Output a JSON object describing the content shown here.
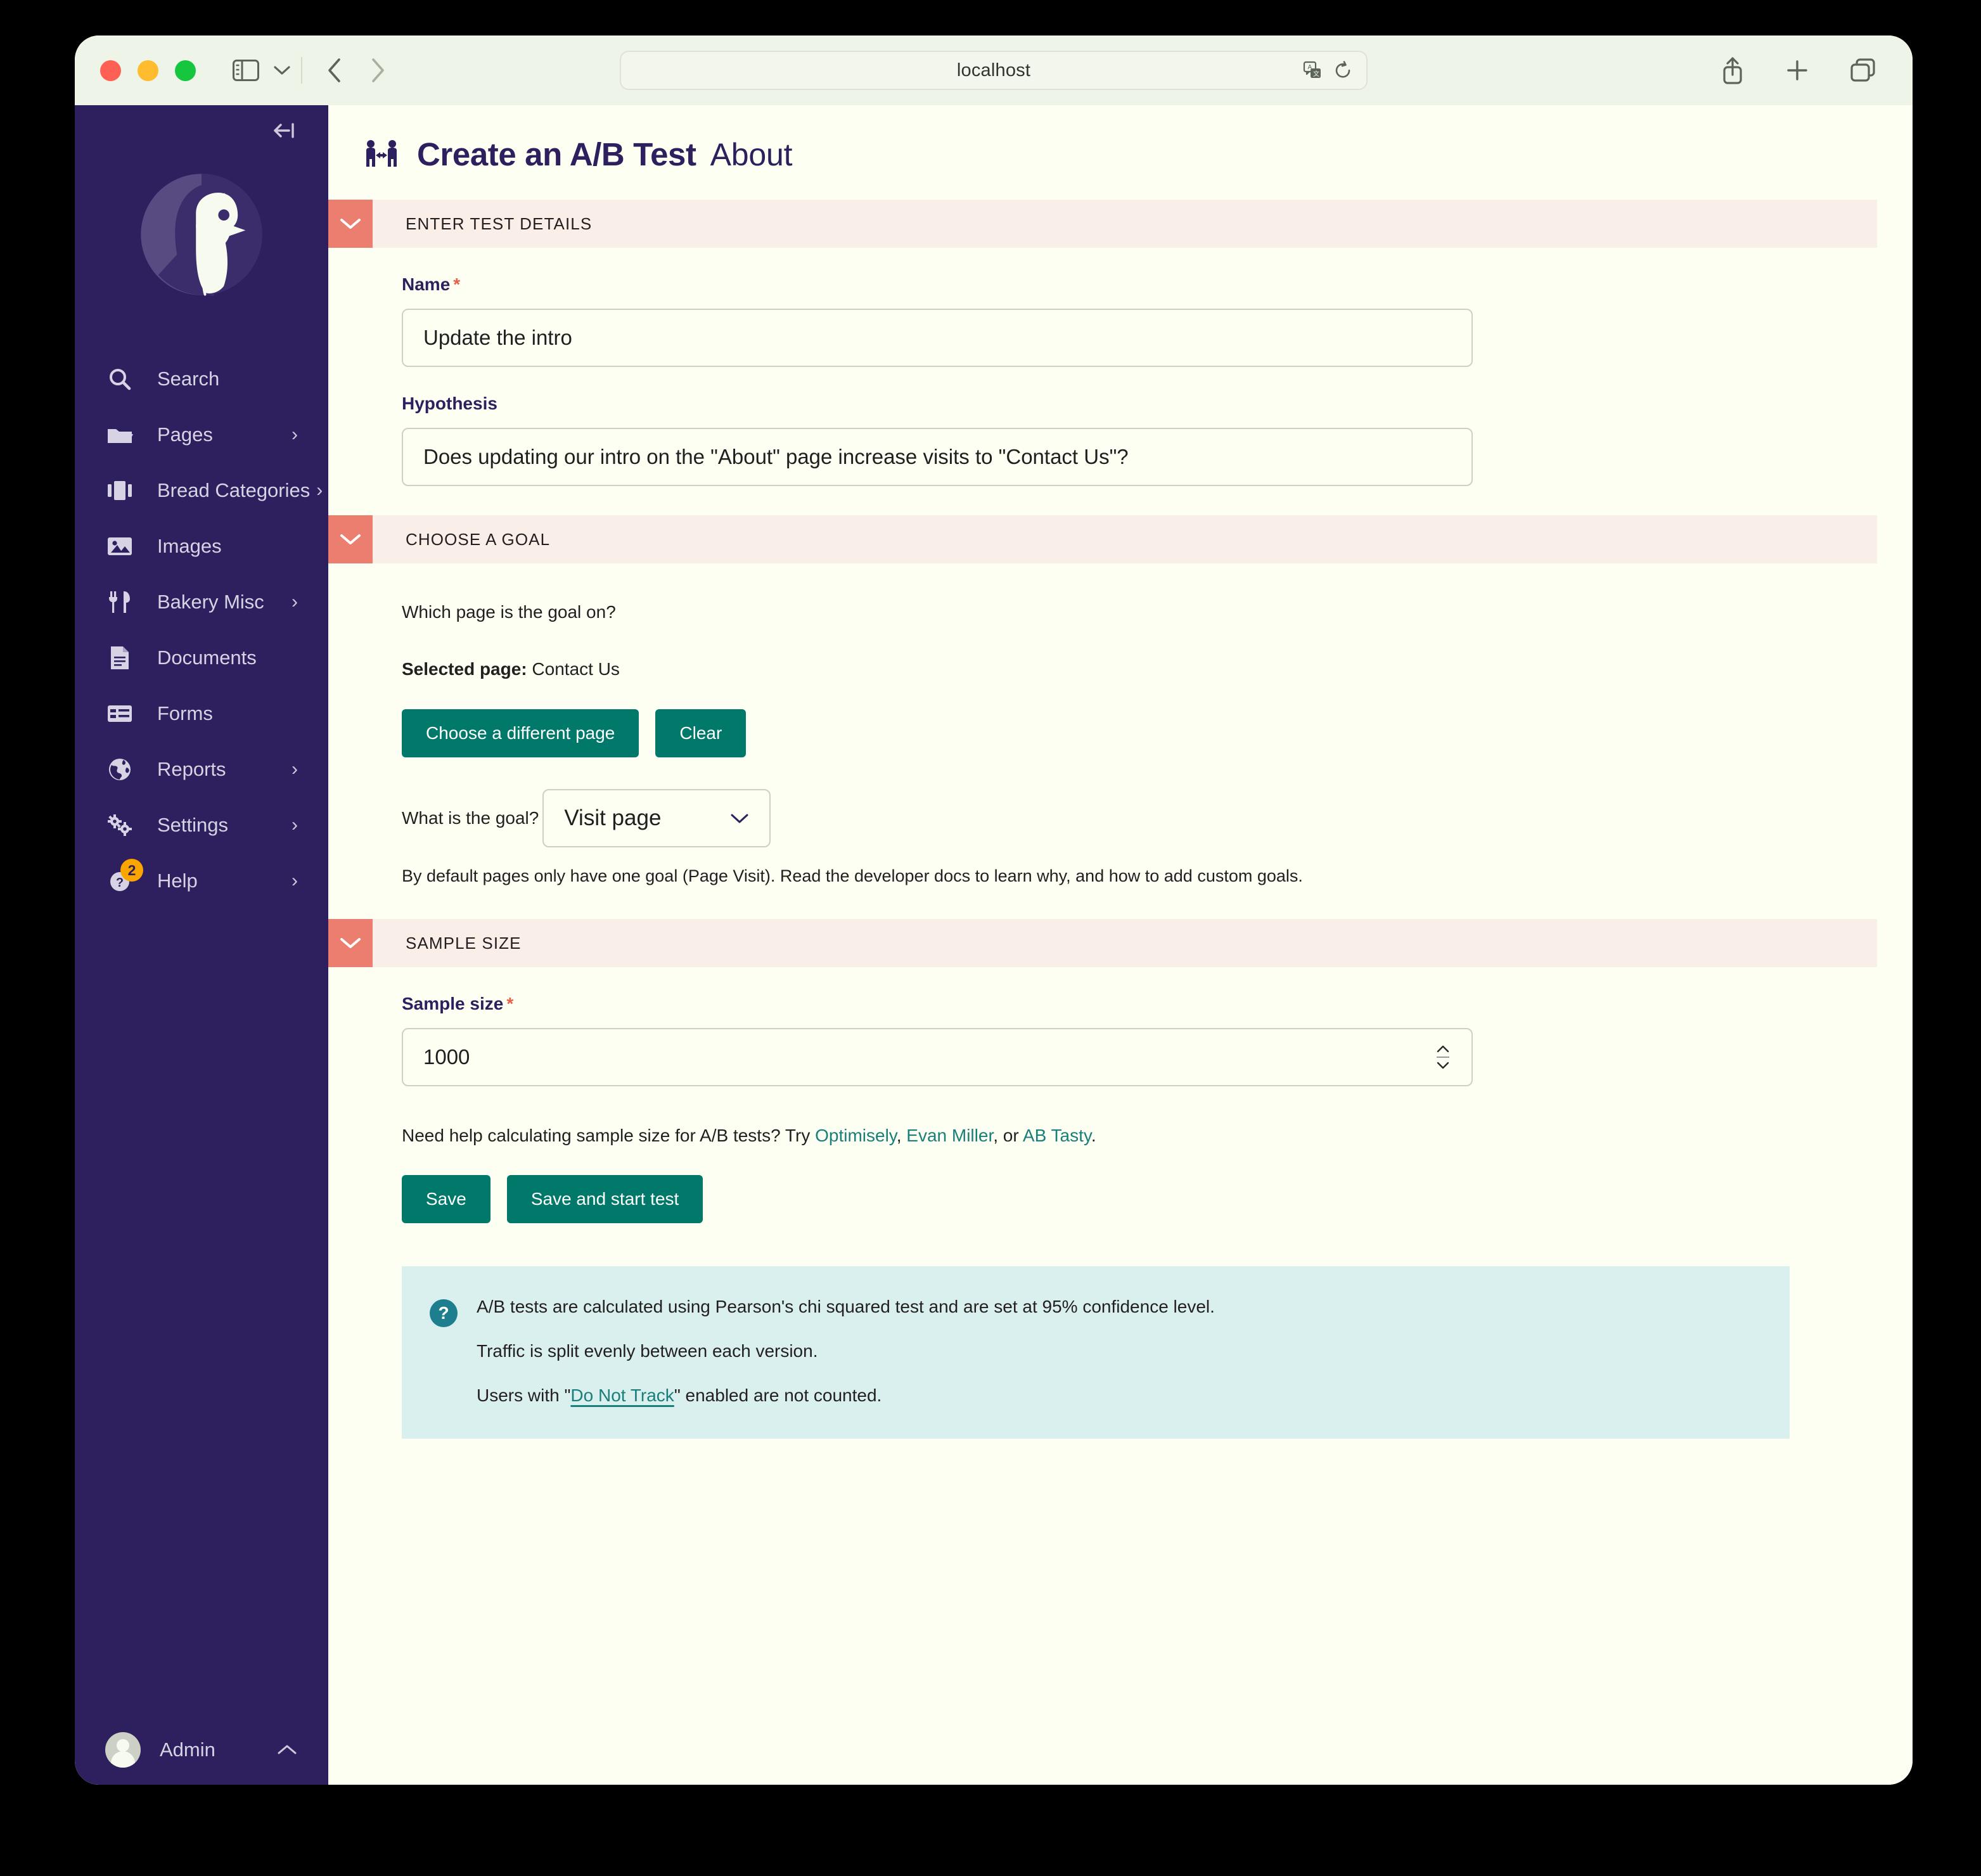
{
  "browser": {
    "url": "localhost",
    "icons": {
      "sidebar_toggle": "sidebar-toggle-icon",
      "tab_overview_chevron": "chevron-down-icon",
      "back": "back-arrow-icon",
      "forward": "forward-arrow-icon",
      "translate": "translate-icon",
      "reload": "reload-icon",
      "share": "share-icon",
      "new_tab": "plus-icon",
      "tabs": "tabs-icon"
    }
  },
  "sidebar": {
    "collapse_icon": "collapse-sidebar-icon",
    "logo": "wagtail-bird-logo",
    "items": [
      {
        "label": "Search",
        "icon": "search-icon",
        "has_submenu": false,
        "badge": null
      },
      {
        "label": "Pages",
        "icon": "folder-icon",
        "has_submenu": true,
        "badge": null
      },
      {
        "label": "Bread Categories",
        "icon": "snippets-icon",
        "has_submenu": true,
        "badge": null
      },
      {
        "label": "Images",
        "icon": "image-icon",
        "has_submenu": false,
        "badge": null
      },
      {
        "label": "Bakery Misc",
        "icon": "cutlery-icon",
        "has_submenu": true,
        "badge": null
      },
      {
        "label": "Documents",
        "icon": "document-icon",
        "has_submenu": false,
        "badge": null
      },
      {
        "label": "Forms",
        "icon": "forms-icon",
        "has_submenu": false,
        "badge": null
      },
      {
        "label": "Reports",
        "icon": "globe-icon",
        "has_submenu": true,
        "badge": null
      },
      {
        "label": "Settings",
        "icon": "cogs-icon",
        "has_submenu": true,
        "badge": null
      },
      {
        "label": "Help",
        "icon": "help-circle-icon",
        "has_submenu": true,
        "badge": "2"
      }
    ],
    "footer": {
      "name": "Admin",
      "avatar": "user-avatar",
      "caret": "chevron-up-icon"
    }
  },
  "header": {
    "icon": "ab-test-icon",
    "title": "Create an A/B Test",
    "subtitle": "About"
  },
  "sections": {
    "details": {
      "heading": "ENTER TEST DETAILS",
      "toggle_icon": "chevron-down-icon",
      "name": {
        "label": "Name",
        "required": "*",
        "value": "Update the intro"
      },
      "hypothesis": {
        "label": "Hypothesis",
        "value": "Does updating our intro on the \"About\" page increase visits to \"Contact Us\"?"
      }
    },
    "goal": {
      "heading": "CHOOSE A GOAL",
      "toggle_icon": "chevron-down-icon",
      "question": "Which page is the goal on?",
      "selected_page_label": "Selected page:",
      "selected_page_value": "Contact Us",
      "choose_button": "Choose a different page",
      "clear_button": "Clear",
      "goal_question": "What is the goal?",
      "goal_value": "Visit page",
      "goal_caret": "chevron-down-icon",
      "hint": "By default pages only have one goal (Page Visit). Read the developer docs to learn why, and how to add custom goals."
    },
    "sample": {
      "heading": "SAMPLE SIZE",
      "toggle_icon": "chevron-down-icon",
      "label": "Sample size",
      "required": "*",
      "value": "1000",
      "spinner_icon": "number-stepper-icon",
      "helper_prefix": "Need help calculating sample size for A/B tests? Try ",
      "link_1": "Optimisely",
      "helper_sep_1": ", ",
      "link_2": "Evan Miller",
      "helper_sep_2": ", or ",
      "link_3": "AB Tasty",
      "helper_suffix": ".",
      "save_button": "Save",
      "save_start_button": "Save and start test"
    }
  },
  "info_panel": {
    "icon": "question-mark-icon",
    "line1": "A/B tests are calculated using Pearson's chi squared test and are set at 95% confidence level.",
    "line2": "Traffic is split evenly between each version.",
    "line3_prefix": "Users with \"",
    "line3_link": "Do Not Track",
    "line3_suffix": "\" enabled are not counted."
  },
  "colors": {
    "sidebar_purple": "#2e1f5e",
    "accent_teal": "#00796b",
    "section_coral": "#ec7e6f",
    "section_header_bg": "#faeee8",
    "page_bg": "#fcfff2",
    "info_bg": "#d9f0ee",
    "required_red": "#e5604b",
    "badge_orange": "#faa500",
    "link_teal": "#1a7e7a"
  }
}
